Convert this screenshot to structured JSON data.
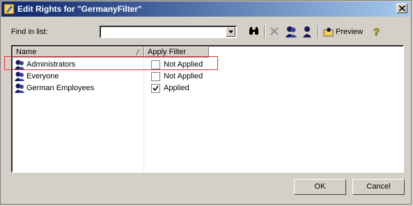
{
  "window": {
    "title": "Edit Rights for \"GermanyFilter\""
  },
  "find": {
    "label": "Find in list:",
    "value": ""
  },
  "toolbar": {
    "preview_label": "Preview"
  },
  "columns": {
    "name": "Name",
    "filter": "Apply Filter"
  },
  "rows": [
    {
      "name": "Administrators",
      "checked": false,
      "status": "Not Applied"
    },
    {
      "name": "Everyone",
      "checked": false,
      "status": "Not Applied"
    },
    {
      "name": "German Employees",
      "checked": true,
      "status": "Applied"
    }
  ],
  "buttons": {
    "ok": "OK",
    "cancel": "Cancel"
  },
  "colors": {
    "title_start": "#0a246a",
    "title_end": "#a6caf0",
    "highlight": "#e03030"
  },
  "icons": [
    "app-icon",
    "close-icon",
    "binoculars-icon",
    "delete-icon",
    "add-user-icon",
    "user-icon",
    "preview-icon",
    "help-icon",
    "sort-icon",
    "dropdown-icon",
    "checkmark-icon"
  ]
}
